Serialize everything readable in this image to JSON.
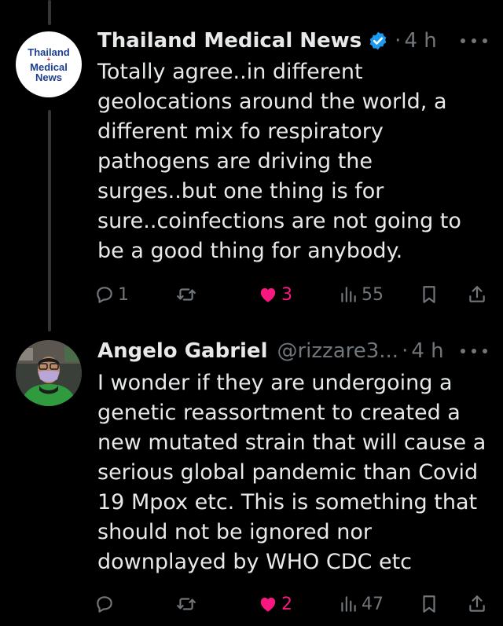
{
  "tweets": [
    {
      "author_name": "Thailand Medical News",
      "verified": true,
      "handle": "",
      "dot": "·",
      "time": "4 h",
      "avatar": {
        "logo_lines": [
          "Thailand",
          "Medical",
          "News"
        ],
        "cross": "+",
        "registered": "®"
      },
      "text_lines": [
        "Totally agree..in different",
        "geolocations around the world, a",
        "different mix fo respiratory",
        "pathogens are driving the",
        "surges..but one thing is for",
        "sure..coinfections are not going to",
        "be a good thing for anybody."
      ],
      "actions": {
        "replies": "1",
        "reposts": "",
        "likes": "3",
        "views": "55"
      }
    },
    {
      "author_name": "Angelo Gabriel",
      "verified": false,
      "handle": "@rizzare3...",
      "dot": "·",
      "time": "4 h",
      "text_lines": [
        "I wonder if they are undergoing  a",
        "genetic reassortment  to created a",
        "new mutated strain that will cause a",
        "serious global pandemic than Covid",
        "19 Mpox etc.  This is something that",
        "should not be ignored  nor",
        "downplayed by WHO CDC etc"
      ],
      "actions": {
        "replies": "",
        "reposts": "",
        "likes": "2",
        "views": "47"
      }
    }
  ],
  "colors": {
    "like_active": "#f91880",
    "verified_blue": "#1d9bf0",
    "muted": "#71767b"
  }
}
